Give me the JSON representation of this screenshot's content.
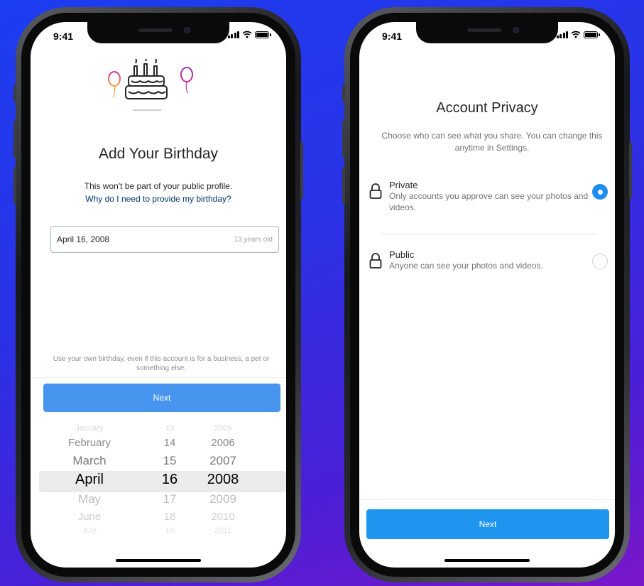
{
  "status_bar": {
    "time": "9:41"
  },
  "birthday_screen": {
    "title": "Add Your Birthday",
    "subtitle": "This won't be part of your public profile.",
    "why_link": "Why do I need to provide my birthday?",
    "date_value": "April 16, 2008",
    "age_text": "13 years old",
    "note": "Use your own birthday, even if this account is for a business, a pet or something else.",
    "next_label": "Next",
    "picker": {
      "months": [
        "January",
        "February",
        "March",
        "April",
        "May",
        "June",
        "July"
      ],
      "days": [
        "13",
        "14",
        "15",
        "16",
        "17",
        "18",
        "19"
      ],
      "years": [
        "2005",
        "2006",
        "2007",
        "2008",
        "2009",
        "2010",
        "2011"
      ],
      "selected_index": 3
    }
  },
  "privacy_screen": {
    "title": "Account Privacy",
    "description": "Choose who can see what you share. You can change this anytime in Settings.",
    "options": [
      {
        "title": "Private",
        "description": "Only accounts you approve can see your photos and videos.",
        "selected": true
      },
      {
        "title": "Public",
        "description": "Anyone can see your photos and videos.",
        "selected": false
      }
    ],
    "next_label": "Next"
  },
  "colors": {
    "accent": "#1f95f0",
    "next_button_left": "#4895ef",
    "background_gradient_start": "#1d3df0",
    "background_gradient_end": "#7a16c9"
  },
  "icons": [
    "birthday-cake-icon",
    "balloon-icon",
    "lock-icon",
    "signal-icon",
    "wifi-icon",
    "battery-icon"
  ]
}
